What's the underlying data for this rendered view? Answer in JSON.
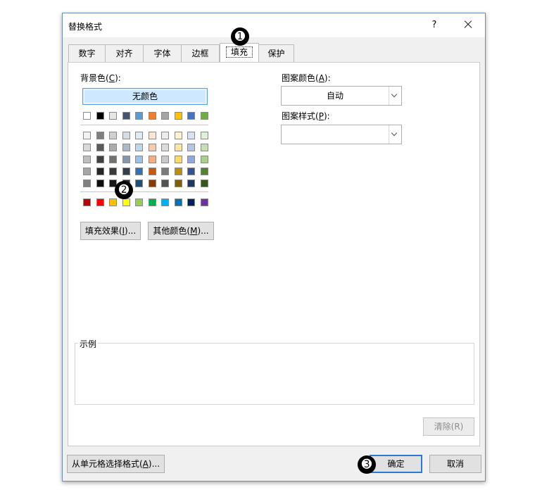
{
  "dialog": {
    "title": "替换格式",
    "help_label": "?"
  },
  "tabs": [
    "数字",
    "对齐",
    "字体",
    "边框",
    "填充",
    "保护"
  ],
  "active_tab": "填充",
  "background_color": {
    "label": "背景色(",
    "accel": "C",
    "label_end": "):",
    "no_color_label": "无颜色",
    "palette": [
      [
        "#ffffff",
        "#000000",
        "#e7e6e6",
        "#44546a",
        "#5b9bd5",
        "#ed7d31",
        "#a5a5a5",
        "#ffc000",
        "#4472c4",
        "#70ad47"
      ],
      [
        "#f2f2f2",
        "#7f7f7f",
        "#d0cece",
        "#d6dce4",
        "#ddebf7",
        "#fce4d6",
        "#ededed",
        "#fff2cc",
        "#d9e1f2",
        "#e2efda"
      ],
      [
        "#d9d9d9",
        "#595959",
        "#aeaaaa",
        "#acb9ca",
        "#bdd7ee",
        "#f8cbad",
        "#dbdbdb",
        "#ffe699",
        "#b4c6e7",
        "#c6e0b4"
      ],
      [
        "#bfbfbf",
        "#404040",
        "#757171",
        "#8497b0",
        "#9bc2e6",
        "#f4b084",
        "#c9c9c9",
        "#ffd966",
        "#8ea9db",
        "#a9d08e"
      ],
      [
        "#a6a6a6",
        "#262626",
        "#3a3838",
        "#333f4f",
        "#2f75b5",
        "#c65911",
        "#7b7b7b",
        "#bf8f00",
        "#305496",
        "#548235"
      ],
      [
        "#808080",
        "#0d0d0d",
        "#161616",
        "#222b35",
        "#1f4e78",
        "#833c0c",
        "#525252",
        "#806000",
        "#203764",
        "#375623"
      ],
      [
        "#c00000",
        "#ff0000",
        "#ffc000",
        "#ffff00",
        "#92d050",
        "#00b050",
        "#00b0f0",
        "#0070c0",
        "#002060",
        "#7030a0"
      ]
    ]
  },
  "fill_effects_btn": {
    "label": "填充效果(",
    "accel": "I",
    "label_end": ")..."
  },
  "more_colors_btn": {
    "label": "其他颜色(",
    "accel": "M",
    "label_end": ")..."
  },
  "pattern_color": {
    "label": "图案颜色(",
    "accel": "A",
    "label_end": "):",
    "value": "自动"
  },
  "pattern_style": {
    "label": "图案样式(",
    "accel": "P",
    "label_end": "):",
    "value": ""
  },
  "sample": {
    "label": "示例"
  },
  "clear_btn": {
    "label": "清除(R)"
  },
  "from_cell_btn": {
    "label": "从单元格选择格式(",
    "accel": "A",
    "label_end": ")..."
  },
  "ok_btn": {
    "label": "确定"
  },
  "cancel_btn": {
    "label": "取消"
  },
  "markers": [
    "➊",
    "➋",
    "➌"
  ]
}
